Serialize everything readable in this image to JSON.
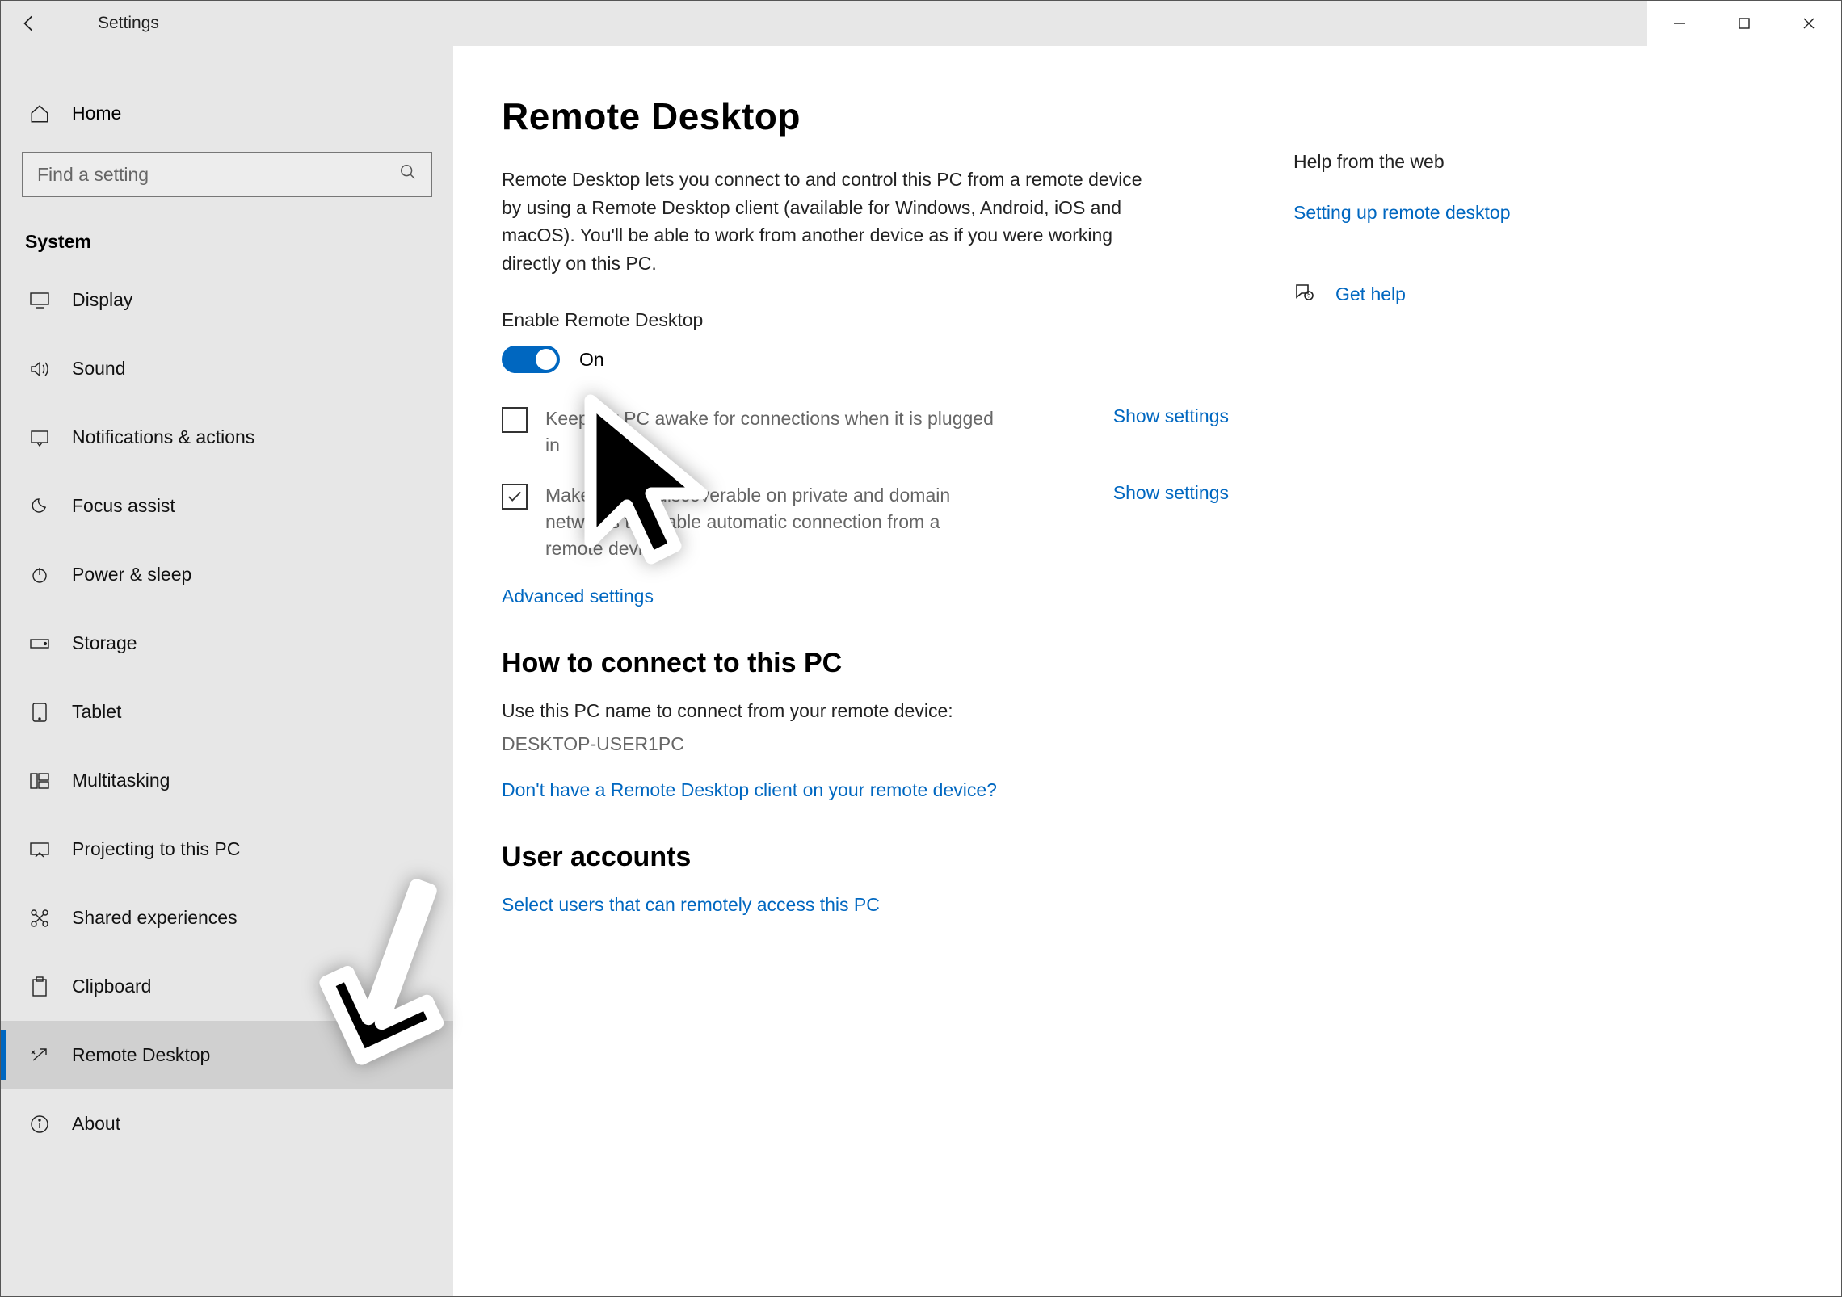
{
  "titlebar": {
    "app_title": "Settings"
  },
  "sidebar": {
    "home_label": "Home",
    "search_placeholder": "Find a setting",
    "category": "System",
    "items": [
      {
        "label": "Display"
      },
      {
        "label": "Sound"
      },
      {
        "label": "Notifications & actions"
      },
      {
        "label": "Focus assist"
      },
      {
        "label": "Power & sleep"
      },
      {
        "label": "Storage"
      },
      {
        "label": "Tablet"
      },
      {
        "label": "Multitasking"
      },
      {
        "label": "Projecting to this PC"
      },
      {
        "label": "Shared experiences"
      },
      {
        "label": "Clipboard"
      },
      {
        "label": "Remote Desktop"
      },
      {
        "label": "About"
      }
    ]
  },
  "page": {
    "title": "Remote Desktop",
    "description": "Remote Desktop lets you connect to and control this PC from a remote device by using a Remote Desktop client (available for Windows, Android, iOS and macOS). You'll be able to work from another device as if you were working directly on this PC.",
    "enable_label": "Enable Remote Desktop",
    "toggle_state": "On",
    "opt1_text": "Keep my PC awake for connections when it is plugged in",
    "opt1_link": "Show settings",
    "opt2_text": "Make my PC discoverable on private and domain networks to enable automatic connection from a remote device",
    "opt2_link": "Show settings",
    "advanced_link": "Advanced settings",
    "howto_heading": "How to connect to this PC",
    "howto_text": "Use this PC name to connect from your remote device:",
    "pc_name": "DESKTOP-USER1PC",
    "no_client_link": "Don't have a Remote Desktop client on your remote device?",
    "accounts_heading": "User accounts",
    "select_users_link": "Select users that can remotely access this PC"
  },
  "aside": {
    "heading": "Help from the web",
    "link1": "Setting up remote desktop",
    "get_help": "Get help"
  }
}
